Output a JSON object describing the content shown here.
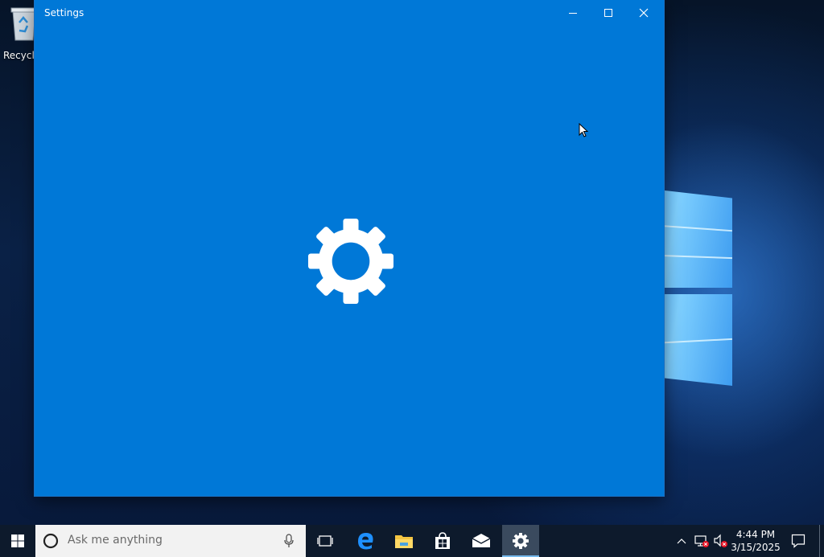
{
  "desktop": {
    "recycle_bin_label": "Recycle",
    "recycle_bin_icon": "recycle-bin-icon"
  },
  "window": {
    "title": "Settings",
    "accent_color": "#0078d7",
    "controls": {
      "minimize_icon": "minimize-icon",
      "maximize_icon": "maximize-icon",
      "close_icon": "close-icon"
    },
    "splash_icon": "gear-icon"
  },
  "taskbar": {
    "start_icon": "windows-start-icon",
    "search_placeholder": "Ask me anything",
    "apps": [
      {
        "name": "task-view",
        "icon": "task-view-icon"
      },
      {
        "name": "edge",
        "icon": "edge-icon"
      },
      {
        "name": "file-explorer",
        "icon": "folder-icon"
      },
      {
        "name": "store",
        "icon": "store-icon"
      },
      {
        "name": "mail",
        "icon": "mail-icon"
      },
      {
        "name": "settings",
        "icon": "gear-icon",
        "active": true
      }
    ],
    "tray": {
      "time": "4:44 PM",
      "date": "3/15/2025"
    }
  }
}
